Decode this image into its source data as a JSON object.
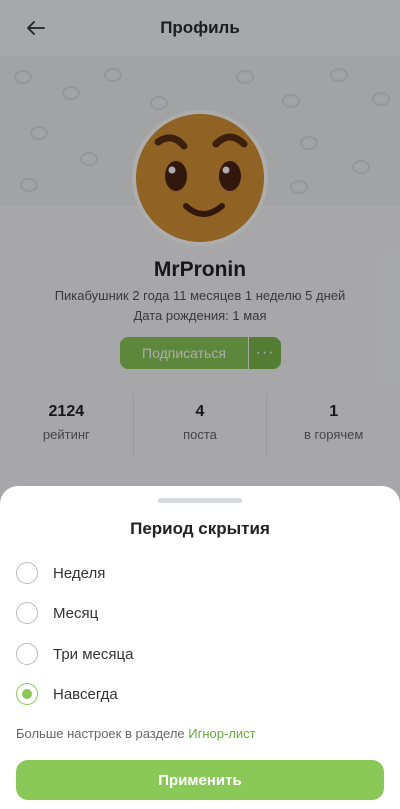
{
  "header": {
    "title": "Профиль",
    "back_icon": "arrow-left-icon"
  },
  "profile": {
    "username": "MrPronin",
    "membership": "Пикабушник 2 года 11 месяцев 1 неделю 5 дней",
    "birthday": "Дата рождения: 1 мая",
    "subscribe_label": "Подписаться",
    "more_label": "···",
    "stats": [
      {
        "value": "2124",
        "label": "рейтинг"
      },
      {
        "value": "4",
        "label": "поста"
      },
      {
        "value": "1",
        "label": "в горячем"
      }
    ]
  },
  "sheet": {
    "title": "Период скрытия",
    "options": [
      {
        "label": "Неделя",
        "checked": false
      },
      {
        "label": "Месяц",
        "checked": false
      },
      {
        "label": "Три месяца",
        "checked": false
      },
      {
        "label": "Навсегда",
        "checked": true
      }
    ],
    "footnote_text": "Больше настроек в разделе ",
    "footnote_link": "Игнор-лист",
    "apply_label": "Применить"
  },
  "colors": {
    "accent": "#8ac858",
    "link": "#6aa73b",
    "overlay": "rgba(0,0,0,0.32)"
  }
}
